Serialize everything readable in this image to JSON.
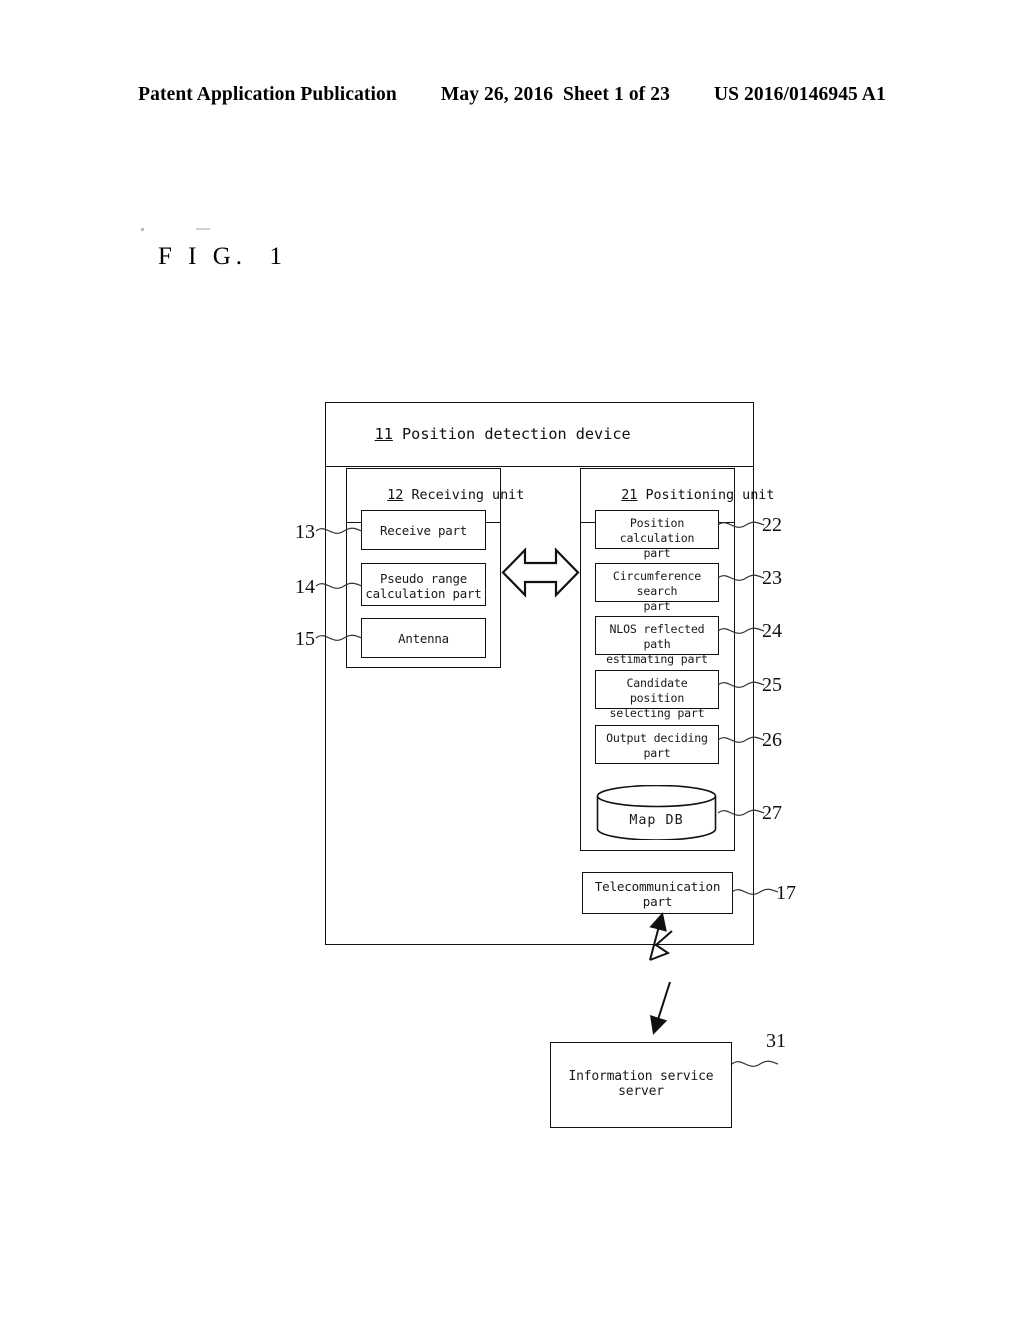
{
  "header": {
    "publication": "Patent Application Publication",
    "date_sheet": "May 26, 2016  Sheet 1 of 23",
    "patent_number": "US 2016/0146945 A1"
  },
  "figure": {
    "caption": "F I G.  1"
  },
  "diagram": {
    "device": {
      "ref": "11",
      "title": "Position detection device"
    },
    "receiving_unit": {
      "ref": "12",
      "title": "Receiving unit",
      "parts": [
        {
          "ref": "13",
          "label": "Receive part"
        },
        {
          "ref": "14",
          "label": "Pseudo range\ncalculation part"
        },
        {
          "ref": "15",
          "label": "Antenna"
        }
      ]
    },
    "positioning_unit": {
      "ref": "21",
      "title": "Positioning unit",
      "parts": [
        {
          "ref": "22",
          "label": "Position calculation\npart"
        },
        {
          "ref": "23",
          "label": "Circumference search\npart"
        },
        {
          "ref": "24",
          "label": "NLOS reflected path\nestimating part"
        },
        {
          "ref": "25",
          "label": "Candidate position\nselecting part"
        },
        {
          "ref": "26",
          "label": "Output deciding\npart"
        },
        {
          "ref": "27",
          "label": "Map DB"
        }
      ]
    },
    "telecommunication_part": {
      "ref": "17",
      "label": "Telecommunication\npart"
    },
    "information_server": {
      "ref": "31",
      "label": "Information service\nserver"
    }
  },
  "colors": {
    "ink": "#111111",
    "page": "#ffffff"
  }
}
